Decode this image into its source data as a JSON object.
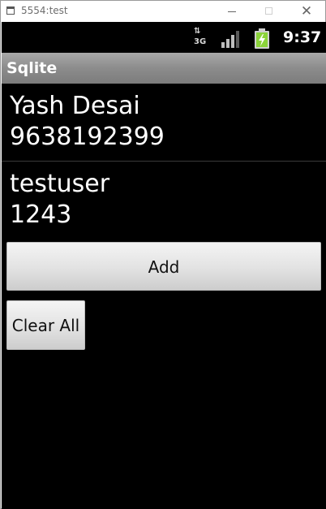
{
  "window": {
    "title": "5554:test",
    "minimize_glyph": "",
    "maximize_glyph": "",
    "close_glyph": "✕"
  },
  "statusbar": {
    "network_label": "3G",
    "network_arrows": "⇅",
    "clock": "9:37",
    "signal_level": 0.75,
    "battery_level": 0.9,
    "colors": {
      "battery": "#8bd33a",
      "signal": "#bdbdbd"
    }
  },
  "actionbar": {
    "title": "Sqlite"
  },
  "contacts": [
    {
      "name": "Yash Desai",
      "phone": "9638192399"
    },
    {
      "name": "testuser",
      "phone": "1243"
    }
  ],
  "buttons": {
    "add_label": "Add",
    "clear_label": "Clear All"
  }
}
